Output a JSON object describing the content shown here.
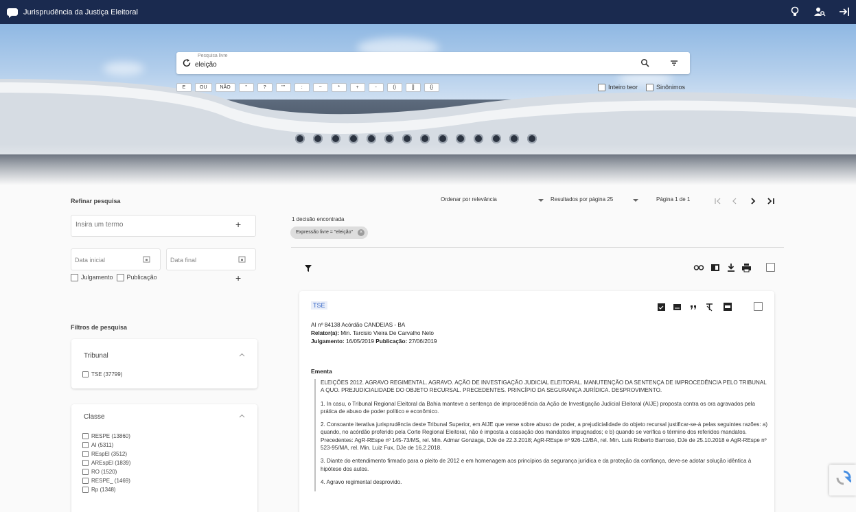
{
  "app": {
    "title": "Jurisprudência da Justiça Eleitoral"
  },
  "colors": {
    "topbar": "#1a2a4f",
    "accent": "#3a69c6",
    "chip_bg": "#dddddd"
  },
  "topbar": {
    "icons": [
      "lightbulb-icon",
      "user-search-icon",
      "logout-icon"
    ]
  },
  "search": {
    "label": "Pesquisa livre",
    "value": "eleição",
    "operators": [
      "E",
      "OU",
      "NÃO",
      "\"",
      "?",
      "\"\"",
      ":",
      "~",
      "*",
      "+",
      "-",
      "()",
      "[]",
      "{}"
    ],
    "options": {
      "inteiro_teor": "Inteiro teor",
      "sinonimos": "Sinônimos"
    }
  },
  "refine": {
    "title": "Refinar pesquisa",
    "term_placeholder": "Insira um termo",
    "date_start": "Data inicial",
    "date_end": "Data final",
    "julgamento": "Julgamento",
    "publicacao": "Publicação"
  },
  "filters": {
    "title": "Filtros de pesquisa",
    "tribunal": {
      "title": "Tribunal",
      "items": [
        "TSE (37799)"
      ]
    },
    "classe": {
      "title": "Classe",
      "items": [
        "RESPE (13860)",
        "AI (5311)",
        "REspEl (3512)",
        "AREspEl (1839)",
        "RO (1520)",
        "RESPE_ (1469)",
        "Rp (1348)"
      ]
    }
  },
  "results_bar": {
    "order_label": "Ordenar por",
    "order_value": "relevância",
    "per_page_label": "Resultados por página",
    "per_page_value": "25",
    "page_info": "Página 1 de 1",
    "count": "1 decisão encontrada",
    "chip": "Expressão livre = \"eleição\""
  },
  "result": {
    "tag": "TSE",
    "line1": "AI nº 84138  Acórdão  CANDEIAS - BA",
    "relator_label": "Relator(a):",
    "relator": "Min. Tarcisio Vieira De Carvalho Neto",
    "julgamento_label": "Julgamento:",
    "julgamento": "16/05/2019",
    "publicacao_label": "Publicação:",
    "publicacao": "27/06/2019",
    "ementa_title": "Ementa",
    "ementa": [
      "ELEIÇÕES 2012. AGRAVO REGIMENTAL. AGRAVO. AÇÃO DE INVESTIGAÇÃO JUDICIAL ELEITORAL. MANUTENÇÃO DA SENTENÇA DE IMPROCEDÊNCIA PELO TRIBUNAL A QUO. PREJUDICIALIDADE DO OBJETO RECURSAL. PRECEDENTES. PRINCÍPIO DA SEGURANÇA JURÍDICA. DESPROVIMENTO.",
      "1. In casu, o Tribunal Regional Eleitoral da Bahia manteve a sentença de improcedência da Ação de Investigação Judicial Eleitoral (AIJE) proposta contra os ora agravados pela prática de abuso de poder político e econômico.",
      "2. Consoante iterativa jurisprudência deste Tribunal Superior, em AIJE que verse sobre abuso de poder, a prejudicialidade do objeto recursal justificar-se-á pelas seguintes razões: a) quando, no acórdão proferido pela Corte Regional Eleitoral, não é imposta a cassação dos mandatos impugnados; e b) quando se verifica o término dos referidos mandatos. Precedentes: AgR-REspe nº 145-73/MS, rel. Min. Admar Gonzaga, DJe de 22.3.2018; AgR-REspe nº 926-12/BA, rel. Min. Luís Roberto Barroso, DJe de 25.10.2018 e AgR-REspe nº 523-95/MA, rel. Min. Luiz Fux, DJe de 16.2.2018.",
      "3. Diante do entendimento firmado para o pleito de 2012 e em homenagem aos princípios da segurança jurídica e da proteção da confiança, deve-se adotar solução idêntica à hipótese dos autos.",
      "4. Agravo regimental desprovido."
    ]
  }
}
